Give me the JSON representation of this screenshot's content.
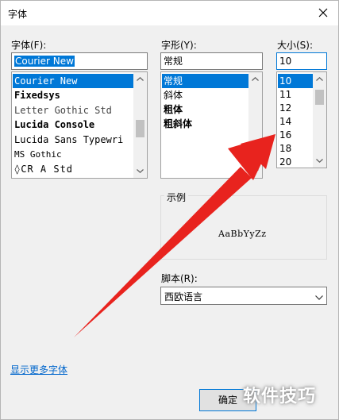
{
  "dialog": {
    "title": "字体"
  },
  "font": {
    "label": "字体(F):",
    "value": "Courier New",
    "items": [
      "Courier New",
      "Fixedsys",
      "Letter Gothic Std",
      "Lucida Console",
      "Lucida Sans Typewri",
      "MS Gothic",
      "◊CR A Std"
    ],
    "selected": "Courier New"
  },
  "style": {
    "label": "字形(Y):",
    "value": "常规",
    "items": [
      "常规",
      "斜体",
      "粗体",
      "粗斜体"
    ],
    "selected": "常规"
  },
  "size": {
    "label": "大小(S):",
    "value": "10",
    "items": [
      "10",
      "11",
      "12",
      "14",
      "16",
      "18",
      "20"
    ],
    "selected": "10"
  },
  "sample": {
    "label": "示例",
    "text": "AaBbYyZz"
  },
  "script": {
    "label": "脚本(R):",
    "value": "西欧语言"
  },
  "more_fonts_link": "显示更多字体",
  "ok_button": "确定",
  "watermark": "软件技巧",
  "colors": {
    "selection": "#0078d7",
    "arrow": "#e8231e",
    "link": "#0066cc"
  }
}
